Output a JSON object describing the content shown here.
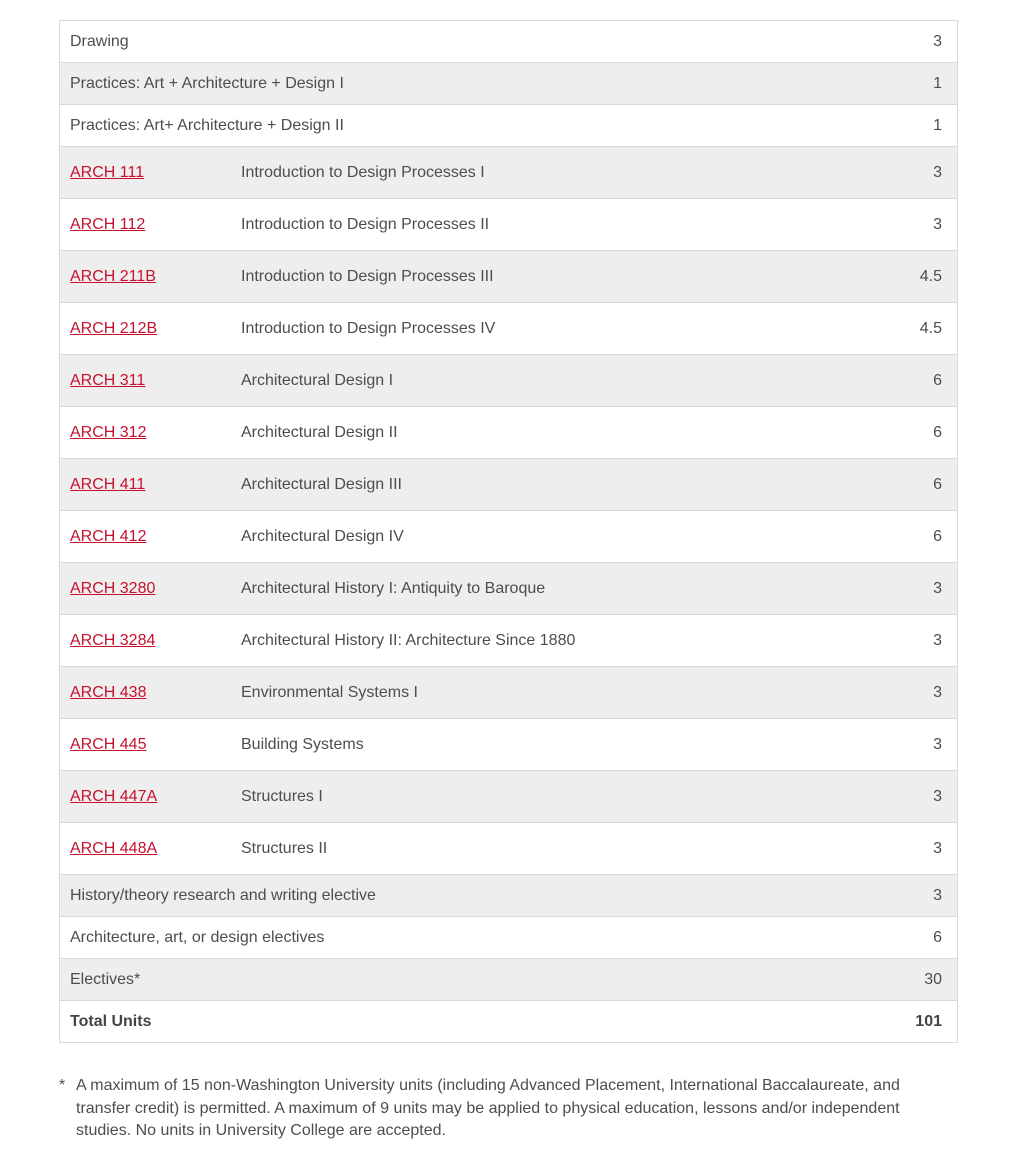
{
  "table": {
    "rows": [
      {
        "type": "plain",
        "title": "Drawing",
        "units": "3"
      },
      {
        "type": "plain",
        "title": "Practices: Art + Architecture + Design I",
        "units": "1"
      },
      {
        "type": "plain",
        "title": "Practices: Art+ Architecture + Design II",
        "units": "1"
      },
      {
        "type": "course",
        "code": "ARCH 111",
        "title": "Introduction to Design Processes I",
        "units": "3"
      },
      {
        "type": "course",
        "code": "ARCH 112",
        "title": "Introduction to Design Processes II",
        "units": "3"
      },
      {
        "type": "course",
        "code": "ARCH 211B",
        "title": "Introduction to Design Processes III",
        "units": "4.5"
      },
      {
        "type": "course",
        "code": "ARCH 212B",
        "title": "Introduction to Design Processes IV",
        "units": "4.5"
      },
      {
        "type": "course",
        "code": "ARCH 311",
        "title": "Architectural Design I",
        "units": "6"
      },
      {
        "type": "course",
        "code": "ARCH 312",
        "title": "Architectural Design II",
        "units": "6"
      },
      {
        "type": "course",
        "code": "ARCH 411",
        "title": "Architectural Design III",
        "units": "6"
      },
      {
        "type": "course",
        "code": "ARCH 412",
        "title": "Architectural Design IV",
        "units": "6"
      },
      {
        "type": "course",
        "code": "ARCH 3280",
        "title": "Architectural History I: Antiquity to Baroque",
        "units": "3"
      },
      {
        "type": "course",
        "code": "ARCH 3284",
        "title": "Architectural History II: Architecture Since 1880",
        "units": "3"
      },
      {
        "type": "course",
        "code": "ARCH 438",
        "title": "Environmental Systems I",
        "units": "3"
      },
      {
        "type": "course",
        "code": "ARCH 445",
        "title": "Building Systems",
        "units": "3"
      },
      {
        "type": "course",
        "code": "ARCH 447A",
        "title": "Structures I",
        "units": "3"
      },
      {
        "type": "course",
        "code": "ARCH 448A",
        "title": "Structures II",
        "units": "3"
      },
      {
        "type": "plain",
        "title": "History/theory research and writing elective",
        "units": "3"
      },
      {
        "type": "plain",
        "title": "Architecture, art, or design electives",
        "units": "6"
      },
      {
        "type": "plain",
        "title": "Electives*",
        "units": "30"
      }
    ],
    "total": {
      "label": "Total Units",
      "units": "101"
    }
  },
  "footnote": {
    "mark": "*",
    "text": "A maximum of 15 non-Washington University units (including Advanced Placement, International Baccalaureate, and transfer credit) is permitted. A maximum of 9 units may be applied to physical education, lessons and/or independent studies. No units in University College are accepted."
  },
  "colors": {
    "link": "#c8102e",
    "row_shade": "#eeeeee",
    "border": "#d9d9d9",
    "text": "#4d4d4d"
  }
}
